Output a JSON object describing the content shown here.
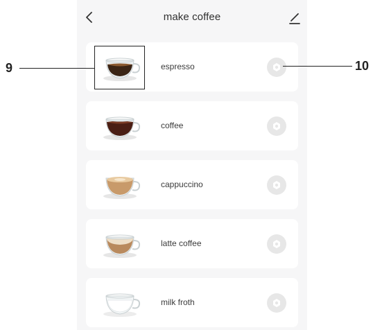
{
  "header": {
    "title": "make coffee",
    "back_icon": "chevron-left-icon",
    "edit_icon": "pencil-icon"
  },
  "drinks": [
    {
      "label": "espresso",
      "icon": "espresso-cup-icon"
    },
    {
      "label": "coffee",
      "icon": "coffee-cup-icon"
    },
    {
      "label": "cappuccino",
      "icon": "cappuccino-cup-icon"
    },
    {
      "label": "latte coffee",
      "icon": "latte-cup-icon"
    },
    {
      "label": "milk froth",
      "icon": "milk-froth-cup-icon"
    }
  ],
  "settings_icon": "gear-icon",
  "callouts": {
    "left": "9",
    "right": "10"
  },
  "colors": {
    "background": "#f6f6f7",
    "card": "#ffffff",
    "gear_bg": "#e7e7e7"
  }
}
